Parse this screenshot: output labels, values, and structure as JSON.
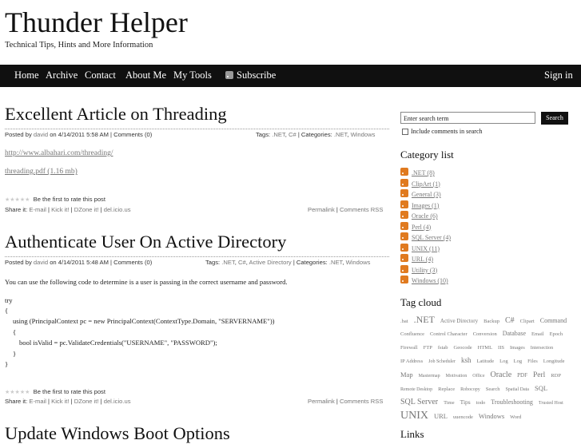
{
  "site": {
    "title": "Thunder Helper",
    "subtitle": "Technical Tips, Hints and More Information"
  },
  "nav": {
    "home": "Home",
    "archive": "Archive",
    "contact": "Contact",
    "about": "About Me",
    "tools": "My Tools",
    "subscribe": "Subscribe",
    "signin": "Sign in"
  },
  "posts": [
    {
      "title": "Excellent Article on Threading",
      "posted_by": "Posted by",
      "author": "david",
      "on": "on 4/14/2011 5:58 AM | Comments (0)",
      "tags_label": "Tags:",
      "tags": [
        ".NET",
        "C#"
      ],
      "cats_label": "| Categories:",
      "cats": [
        ".NET",
        "Windows"
      ],
      "links": [
        "http://www.albahari.com/threading/",
        "threading.pdf (1.16 mb)"
      ],
      "stars": "★★★★★",
      "rate": "Be the first to rate this post",
      "share_label": "Share it:",
      "share": [
        "E-mail",
        "Kick it!",
        "DZone it!",
        "del.icio.us"
      ],
      "permalink": "Permalink",
      "comments_rss": "Comments RSS"
    },
    {
      "title": "Authenticate User On Active Directory",
      "posted_by": "Posted by",
      "author": "david",
      "on": "on 4/14/2011 5:48 AM | Comments (0)",
      "tags_label": "Tags:",
      "tags": [
        ".NET",
        "C#",
        "Active Directory"
      ],
      "cats_label": "| Categories:",
      "cats": [
        ".NET",
        "Windows"
      ],
      "intro": "You can use the following code to determine is a user is passing in the correct username and password.",
      "code": [
        "try",
        "{",
        "using (PrincipalContext pc = new PrincipalContext(ContextType.Domain, \"SERVERNAME\"))",
        "{",
        "bool isValid = pc.ValidateCredentials(\"USERNAME\", \"PASSWORD\");",
        "}",
        "}"
      ],
      "stars": "★★★★★",
      "rate": "Be the first to rate this post",
      "share_label": "Share it:",
      "share": [
        "E-mail",
        "Kick it!",
        "DZone it!",
        "del.icio.us"
      ],
      "permalink": "Permalink",
      "comments_rss": "Comments RSS"
    },
    {
      "title": "Update Windows Boot Options"
    }
  ],
  "sidebar": {
    "search_value": "Enter search term",
    "search_button": "Search",
    "include_comments": "Include comments in search",
    "category_heading": "Category list",
    "categories": [
      ".NET (8)",
      "ClipArt (1)",
      "General (3)",
      "Images (1)",
      "Oracle (6)",
      "Perl (4)",
      "SQL Server (4)",
      "UNIX (11)",
      "URL (4)",
      "Utility (3)",
      "Windows (10)"
    ],
    "tag_heading": "Tag cloud",
    "tags": [
      ".bat",
      ".NET",
      "Active Directory",
      "Backup",
      "C#",
      "Clipart",
      "Command",
      "Confluence",
      "Control Character",
      "Conversion",
      "Database",
      "Email",
      "Epoch",
      "Firewall",
      "FTP",
      "fstab",
      "Geocode",
      "HTML",
      "IIS",
      "Images",
      "Intersection",
      "IP Address",
      "Job Scheduler",
      "ksh",
      "Latitude",
      "Log",
      "Log",
      "Files",
      "Longitude",
      "Map",
      "Mastermap",
      "Motivation",
      "Office",
      "Oracle",
      "PDF",
      "Perl",
      "RDP",
      "Remote Desktop",
      "Replace",
      "Robocopy",
      "Search",
      "Spatial Data",
      "SQL",
      "SQL Server",
      "Time",
      "Tips",
      "todo",
      "Troubleshooting",
      "Trusted Host",
      "UNIX",
      "URL",
      "uuencode",
      "Windows",
      "Word"
    ],
    "links_heading": "Links"
  }
}
